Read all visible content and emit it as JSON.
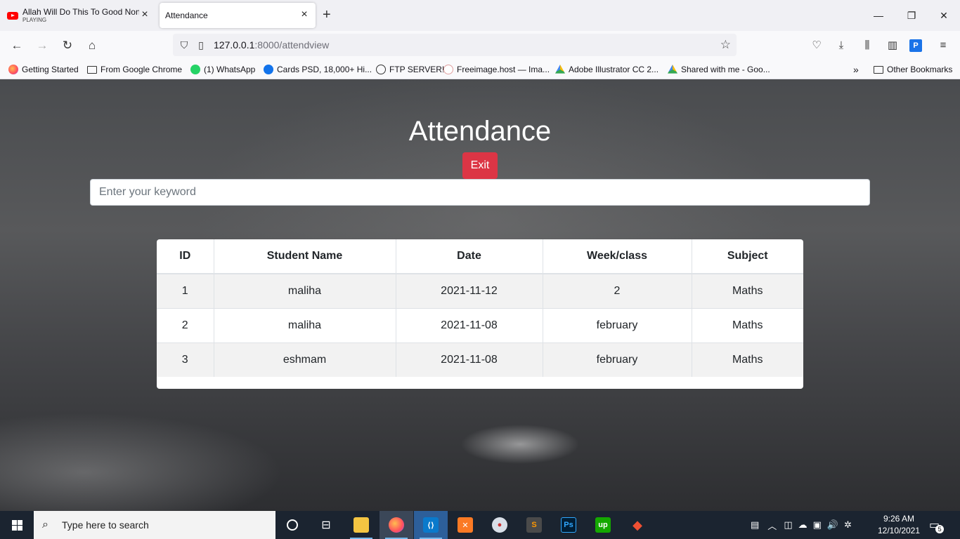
{
  "browser": {
    "tabs": [
      {
        "title": "Allah Will Do This To Good Non",
        "subtitle": "PLAYING",
        "icon": "youtube-icon"
      },
      {
        "title": "Attendance",
        "subtitle": ""
      }
    ],
    "url_host": "127.0.0.1",
    "url_path": ":8000/attendview",
    "bookmarks": [
      {
        "label": "Getting Started",
        "icon": "firefox-icon"
      },
      {
        "label": "From Google Chrome",
        "icon": "folder-icon"
      },
      {
        "label": "(1) WhatsApp",
        "icon": "whatsapp-icon"
      },
      {
        "label": "Cards PSD, 18,000+ Hi...",
        "icon": "freepik-icon"
      },
      {
        "label": "FTP SERVER!",
        "icon": "globe-icon"
      },
      {
        "label": "Freeimage.host — Ima...",
        "icon": "freeimage-icon"
      },
      {
        "label": "Adobe Illustrator CC 2...",
        "icon": "google-drive-icon"
      },
      {
        "label": "Shared with me - Goo...",
        "icon": "google-drive-icon"
      }
    ],
    "other_bookmarks": "Other Bookmarks"
  },
  "page": {
    "title": "Attendance",
    "exit_label": "Exit",
    "search_placeholder": "Enter your keyword",
    "table": {
      "headers": [
        "ID",
        "Student Name",
        "Date",
        "Week/class",
        "Subject"
      ],
      "rows": [
        [
          "1",
          "maliha",
          "2021-11-12",
          "2",
          "Maths"
        ],
        [
          "2",
          "maliha",
          "2021-11-08",
          "february",
          "Maths"
        ],
        [
          "3",
          "eshmam",
          "2021-11-08",
          "february",
          "Maths"
        ]
      ]
    }
  },
  "taskbar": {
    "search_placeholder": "Type here to search",
    "time": "9:26 AM",
    "date": "12/10/2021",
    "notification_count": "5"
  },
  "colors": {
    "exit_button": "#dc3545",
    "taskbar": "#1b2430",
    "tab_bar": "#f0f0f4"
  }
}
